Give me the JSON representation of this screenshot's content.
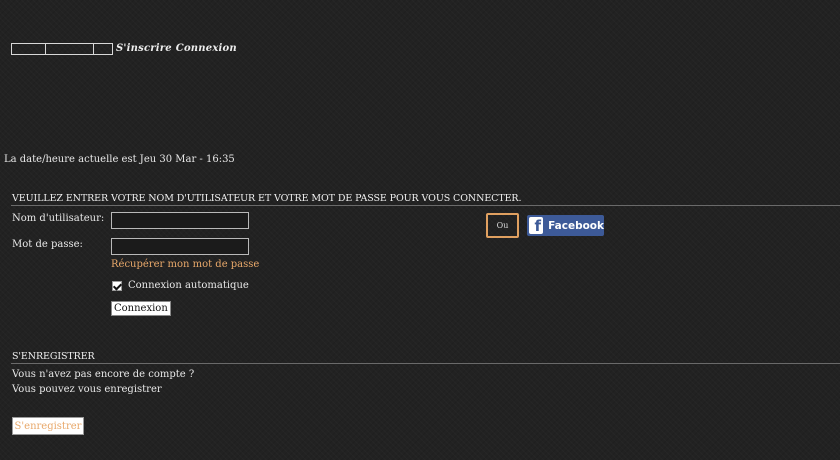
{
  "nav": {
    "register_link": "S'inscrire",
    "login_link": "Connexion"
  },
  "datetime_text": "La date/heure actuelle est Jeu 30 Mar - 16:35",
  "login": {
    "heading": "VEUILLEZ ENTRER VOTRE NOM D'UTILISATEUR ET VOTRE MOT DE PASSE POUR VOUS CONNECTER.",
    "username_label": "Nom d'utilisateur:",
    "username_value": "",
    "password_label": "Mot de passe:",
    "password_value": "",
    "forgot_link": "Récupérer mon mot de passe",
    "auto_login_label": "Connexion automatique",
    "auto_login_checked": true,
    "submit_label": "Connexion",
    "or_label": "Ou",
    "facebook_icon": "facebook-icon",
    "facebook_label": "Facebook",
    "facebook_color": "#3d5a98"
  },
  "register": {
    "heading": "S'ENREGISTRER",
    "line1": "Vous n'avez pas encore de compte ?",
    "line2": "Vous pouvez vous enregistrer",
    "button_label": "S'enregistrer"
  },
  "colors": {
    "background": "#222222",
    "link_accent": "#e8a86a"
  }
}
